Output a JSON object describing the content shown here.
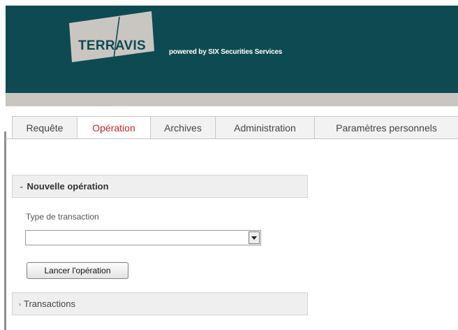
{
  "brand": {
    "logo_text": "TERRAVIS",
    "powered_by": "powered by SIX Securities Services",
    "colors": {
      "header": "#0e4a52",
      "logo_bg": "#c9c6c1",
      "active_tab": "#d2232a"
    }
  },
  "tabs": [
    {
      "label": "Requête",
      "active": false
    },
    {
      "label": "Opération",
      "active": true
    },
    {
      "label": "Archives",
      "active": false
    },
    {
      "label": "Administration",
      "active": false
    },
    {
      "label": "Paramètres personnels",
      "active": false
    }
  ],
  "new_operation": {
    "title": "Nouvelle opération",
    "chevron_icon": "chevron-down-icon",
    "field_label": "Type de transaction",
    "select_value": "",
    "launch_button": "Lancer l'opération"
  },
  "transactions": {
    "title": "Transactions",
    "chevron_icon": "chevron-right-icon"
  }
}
